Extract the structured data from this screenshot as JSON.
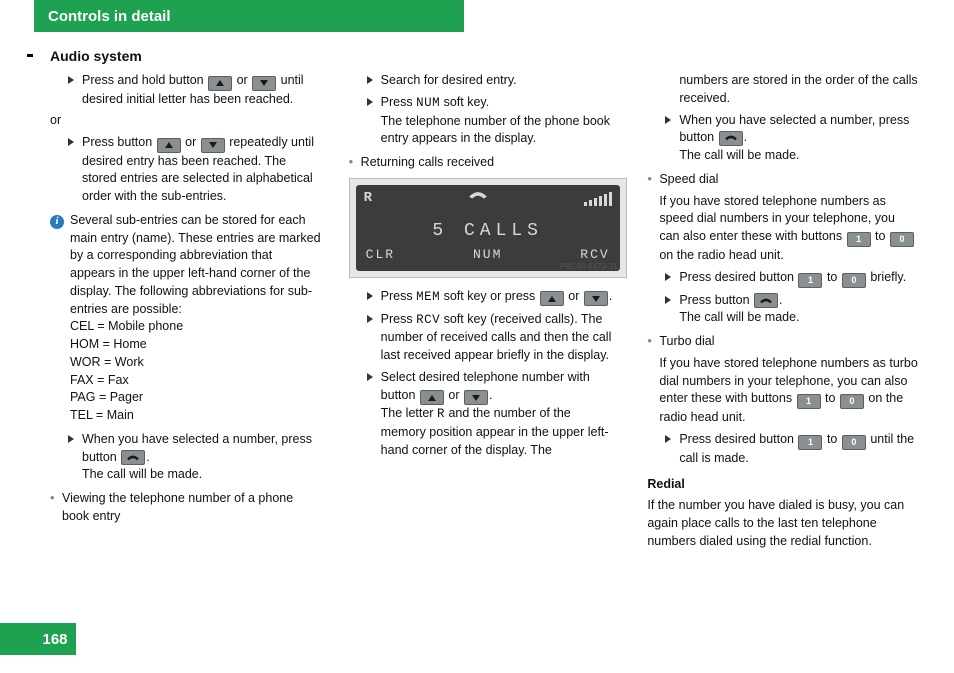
{
  "header": {
    "title": "Controls in detail"
  },
  "page_number": "168",
  "section_title": "Audio system",
  "col1": {
    "item1": "Press and hold button ",
    "item1_mid": " or ",
    "item1_end": " until desired initial letter has been reached.",
    "or": "or",
    "item2": "Press button ",
    "item2_mid": " or ",
    "item2_end": " repeatedly until desired entry has been reached. The stored entries are selected in alphabetical order with the sub-entries.",
    "info": "Several sub-entries can be stored for each main entry (name). These entries are marked by a corresponding abbreviation that appears in the upper left-hand corner of the display. The following abbreviations for sub-entries are possible:",
    "abbr1": "CEL = Mobile phone",
    "abbr2": "HOM = Home",
    "abbr3": "WOR = Work",
    "abbr4": "FAX = Fax",
    "abbr5": "PAG = Pager",
    "abbr6": "TEL = Main",
    "item3a": "When you have selected a number, press button ",
    "item3b": ".",
    "item3c": "The call will be made.",
    "view_heading": "Viewing the telephone number of a phone book entry"
  },
  "col2": {
    "search": "Search for desired entry.",
    "num1": "Press ",
    "num_key": "NUM",
    "num2": " soft key.",
    "num3": "The telephone number of the phone book entry appears in the display.",
    "returning": "Returning calls received",
    "lcd_r": "R",
    "lcd_center": "5  CALLS",
    "lcd_clr": "CLR",
    "lcd_num": "NUM",
    "lcd_rcv": "RCV",
    "lcd_code": "P82.60-6473-31",
    "mem1": "Press ",
    "mem_key": "MEM",
    "mem2": " soft key or press ",
    "mem_or": " or ",
    "mem_end": ".",
    "rcv1": "Press ",
    "rcv_key": "RCV",
    "rcv2": " soft key (received calls). The number of received calls and then the call last received appear briefly in the display.",
    "sel1": "Select desired telephone number with button ",
    "sel_or": " or ",
    "sel_end": ".",
    "sel2a": "The letter ",
    "sel_R": "R",
    "sel2b": " and the number of the memory position appear in the upper left-hand corner of the display. The"
  },
  "col3": {
    "cont": "numbers are stored in the order of the calls received.",
    "whensel1": "When you have selected a number, press button ",
    "whensel2": ".",
    "whensel3": "The call will be made.",
    "speed_head": "Speed dial",
    "speed_intro1": "If you have stored telephone numbers as speed dial numbers in your telephone, you can also enter these with buttons ",
    "to": " to ",
    "speed_intro2": " on the radio head unit.",
    "sd_press1": "Press desired button ",
    "sd_press_to": " to ",
    "sd_press2": " briefly.",
    "sd_call1": "Press button ",
    "sd_call2": ".",
    "sd_call3": "The call will be made.",
    "turbo_head": "Turbo dial",
    "turbo_intro1": "If you have stored telephone numbers as turbo dial numbers in your telephone, you can also enter these with buttons ",
    "turbo_intro2": " on the radio head unit.",
    "td_press1": "Press desired button ",
    "td_press_to": " to ",
    "td_press2": " until the call is made.",
    "redial_head": "Redial",
    "redial_body": "If the number you have dialed is busy, you can again place calls to the last ten telephone numbers dialed using the redial function.",
    "d1": "1",
    "d0": "0"
  }
}
